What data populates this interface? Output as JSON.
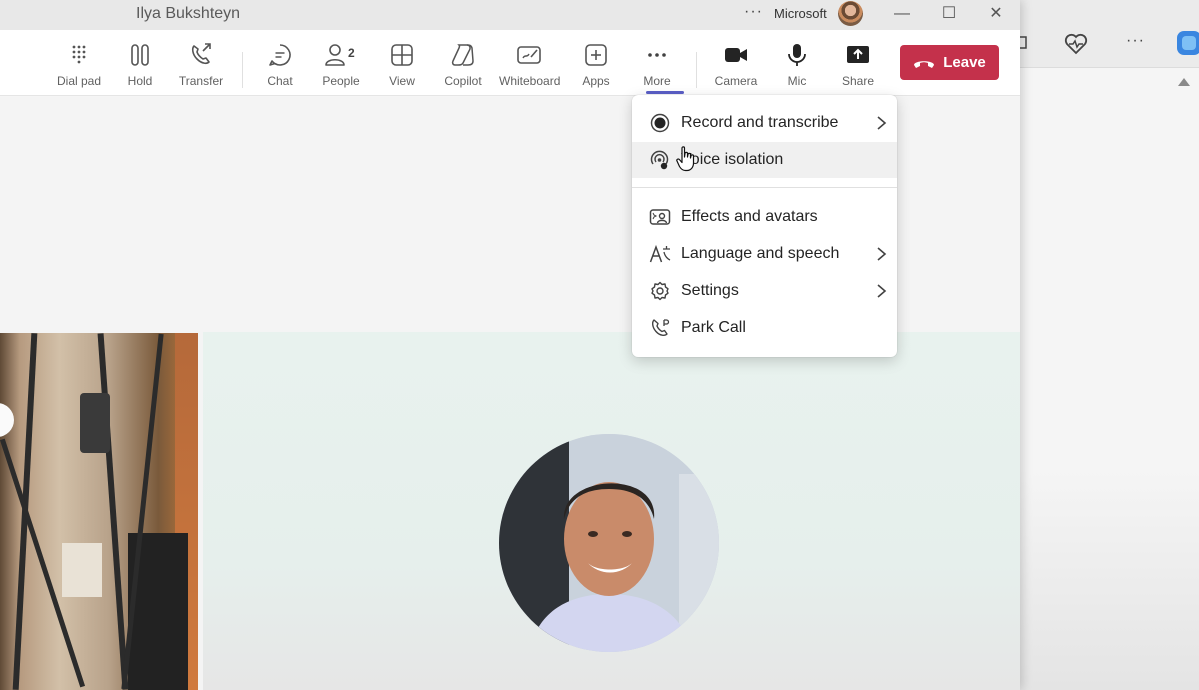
{
  "window": {
    "title": "Ilya Bukshteyn",
    "overflow_menu": "···",
    "org_name": "Microsoft",
    "controls": {
      "minimize": "—",
      "maximize": "☐",
      "close": "✕"
    }
  },
  "toolbar": {
    "items": [
      {
        "label": "Dial pad",
        "icon": "dialpad-icon"
      },
      {
        "label": "Hold",
        "icon": "hold-icon"
      },
      {
        "label": "Transfer",
        "icon": "transfer-icon"
      },
      {
        "label": "Chat",
        "icon": "chat-icon"
      },
      {
        "label": "People",
        "icon": "people-icon",
        "count": "2"
      },
      {
        "label": "View",
        "icon": "view-icon"
      },
      {
        "label": "Copilot",
        "icon": "copilot-icon"
      },
      {
        "label": "Whiteboard",
        "icon": "whiteboard-icon"
      },
      {
        "label": "Apps",
        "icon": "apps-icon"
      },
      {
        "label": "More",
        "icon": "more-icon",
        "active": true
      },
      {
        "label": "Camera",
        "icon": "camera-icon"
      },
      {
        "label": "Mic",
        "icon": "mic-icon"
      },
      {
        "label": "Share",
        "icon": "share-icon"
      }
    ],
    "leave_label": "Leave",
    "accent_color": "#5b5fc7",
    "leave_color": "#c4314b"
  },
  "more_menu": {
    "items": [
      {
        "label": "Record and transcribe",
        "icon": "record-icon",
        "submenu": true
      },
      {
        "label": "Voice isolation",
        "icon": "voice-isolation-icon",
        "submenu": false,
        "hovered": true
      },
      {
        "label": "Effects and avatars",
        "icon": "effects-icon",
        "submenu": false
      },
      {
        "label": "Language and speech",
        "icon": "language-icon",
        "submenu": true
      },
      {
        "label": "Settings",
        "icon": "settings-icon",
        "submenu": true
      },
      {
        "label": "Park Call",
        "icon": "park-call-icon",
        "submenu": false
      }
    ]
  },
  "background_app": {
    "icons": [
      "calendar-icon",
      "health-icon",
      "ellipsis-icon",
      "copilot-app-icon"
    ],
    "ellipsis": "···"
  }
}
